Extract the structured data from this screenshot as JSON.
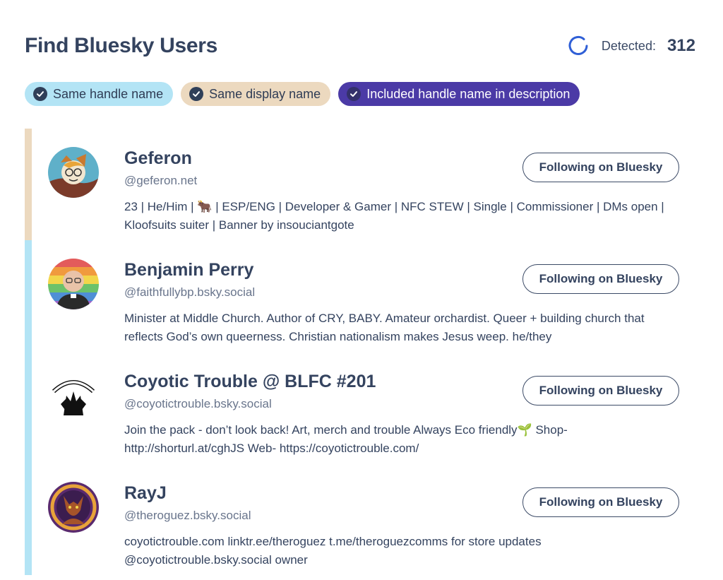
{
  "header": {
    "title": "Find Bluesky Users",
    "detected_label": "Detected:",
    "detected_count": "312"
  },
  "filters": [
    {
      "label": "Same handle name",
      "color": "#b3e4f5"
    },
    {
      "label": "Same display name",
      "color": "#ecd9bf"
    },
    {
      "label": "Included handle name in description",
      "color": "#4b3aa6"
    }
  ],
  "users": [
    {
      "name": "Geferon",
      "handle": "@geferon.net",
      "description": "23 | He/Him | 🐂 | ESP/ENG | Developer & Gamer | NFC STEW | Single | Commissioner | DMs open | Kloofsuits suiter | Banner by insouciantgote",
      "button_label": "Following on Bluesky",
      "match_color": "#ecd9bf"
    },
    {
      "name": "Benjamin Perry",
      "handle": "@faithfullybp.bsky.social",
      "description": "Minister at Middle Church. Author of CRY, BABY. Amateur orchardist. Queer + building church that reflects God’s own queerness. Christian nationalism makes Jesus weep. he/they",
      "button_label": "Following on Bluesky",
      "match_color": "#b3e4f5"
    },
    {
      "name": "Coyotic Trouble @ BLFC #201",
      "handle": "@coyotictrouble.bsky.social",
      "description": "Join the pack - don’t look back! Art, merch and trouble Always Eco friendly🌱 Shop- http://shorturl.at/cghJS Web- https://coyotictrouble.com/",
      "button_label": "Following on Bluesky",
      "match_color": "#b3e4f5"
    },
    {
      "name": "RayJ",
      "handle": "@theroguez.bsky.social",
      "description": "coyotictrouble.com linktr.ee/theroguez t.me/theroguezcomms for store updates @coyotictrouble.bsky.social owner",
      "button_label": "Following on Bluesky",
      "match_color": "#b3e4f5"
    }
  ],
  "icons": {
    "spinner": "loading-spinner-icon",
    "check": "check-circle-icon"
  },
  "colors": {
    "accent": "#2f5fd6",
    "text": "#34435f",
    "muted": "#69758c"
  }
}
